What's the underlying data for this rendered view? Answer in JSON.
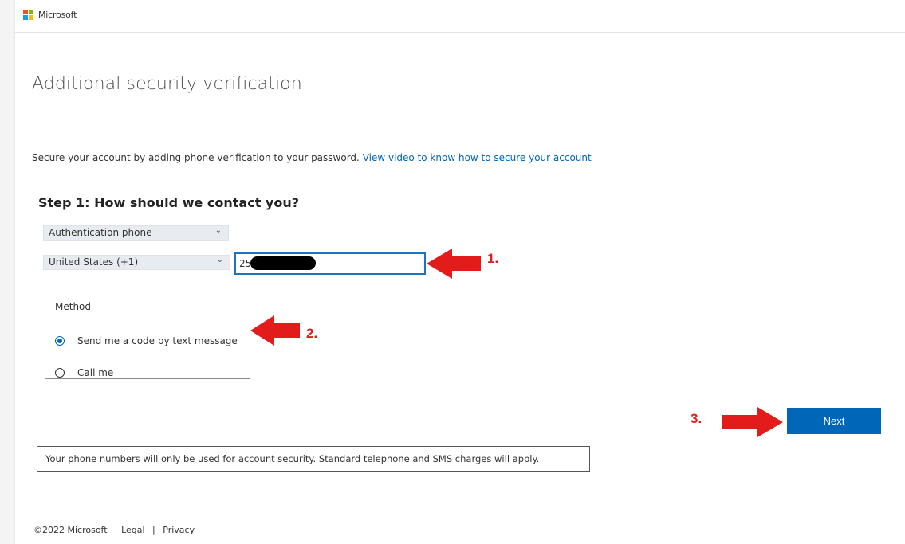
{
  "header": {
    "brand": "Microsoft",
    "logo_colors": [
      "#f25022",
      "#7fba00",
      "#00a4ef",
      "#ffb900"
    ]
  },
  "page": {
    "title": "Additional security verification",
    "intro_text": "Secure your account by adding phone verification to your password.",
    "intro_link": "View video to know how to secure your account"
  },
  "step1": {
    "title": "Step 1: How should we contact you?",
    "contact_method": "Authentication phone",
    "country": "United States (+1)",
    "phone_value": "25"
  },
  "method": {
    "legend": "Method",
    "options": [
      {
        "label": "Send me a code by text message",
        "checked": true
      },
      {
        "label": "Call me",
        "checked": false
      }
    ]
  },
  "next_label": "Next",
  "notice": "Your phone numbers will only be used for account security. Standard telephone and SMS charges will apply.",
  "footer": {
    "copyright": "©2022 Microsoft",
    "legal": "Legal",
    "separator": "|",
    "privacy": "Privacy"
  },
  "annotations": [
    "1.",
    "2.",
    "3."
  ],
  "colors": {
    "accent": "#0067b8",
    "annotation": "#e21b1b"
  }
}
